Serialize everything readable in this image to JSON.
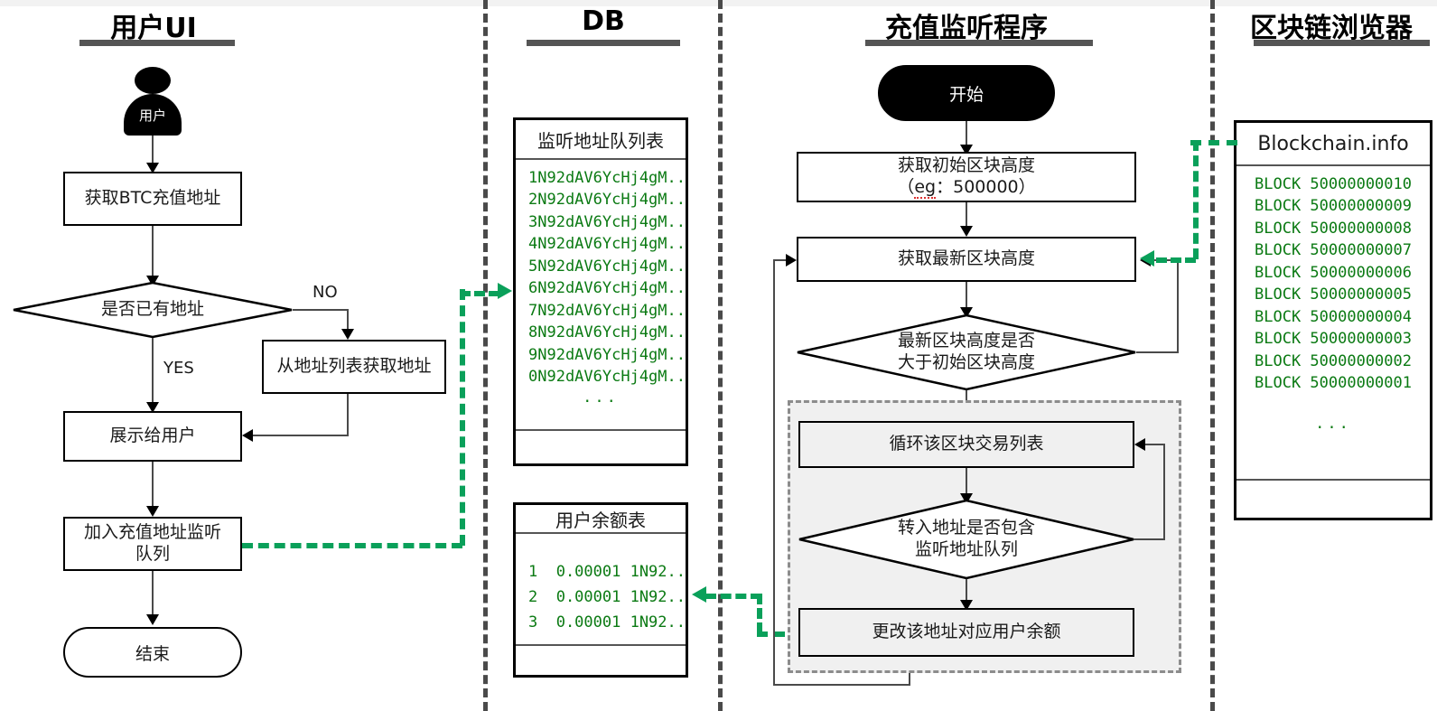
{
  "columns": [
    {
      "id": "user-ui",
      "title": "用户UI"
    },
    {
      "id": "db",
      "title": "DB"
    },
    {
      "id": "listener",
      "title": "充值监听程序"
    },
    {
      "id": "explorer",
      "title": "区块链浏览器"
    }
  ],
  "user_ui": {
    "actor_label": "用户",
    "nodes": [
      {
        "id": "get-btc-address",
        "label": "获取BTC充值地址"
      },
      {
        "id": "has-address-decision",
        "label": "是否已有地址"
      },
      {
        "id": "get-from-list",
        "label": "从地址列表获取地址"
      },
      {
        "id": "show-to-user",
        "label": "展示给用户"
      },
      {
        "id": "join-watch-queue",
        "label": "加入充值地址监听\n队列"
      },
      {
        "id": "end",
        "label": "结束"
      }
    ],
    "edge_no": "NO",
    "edge_yes": "YES"
  },
  "db": {
    "address_table": {
      "title": "监听地址队列表",
      "rows": [
        "1N92dAV6YcHj4gM...",
        "2N92dAV6YcHj4gM...",
        "3N92dAV6YcHj4gM...",
        "4N92dAV6YcHj4gM...",
        "5N92dAV6YcHj4gM...",
        "6N92dAV6YcHj4gM...",
        "7N92dAV6YcHj4gM...",
        "8N92dAV6YcHj4gM...",
        "9N92dAV6YcHj4gM...",
        "0N92dAV6YcHj4gM..."
      ],
      "ellipsis": "..."
    },
    "balance_table": {
      "title": "用户余额表",
      "rows": [
        "1  0.00001 1N92...",
        "2  0.00001 1N92...",
        "3  0.00001 1N92..."
      ],
      "ellipsis": "..."
    }
  },
  "listener": {
    "start": "开始",
    "get_initial_height_line1": "获取初始区块高度",
    "get_initial_height_line2_pre": "（",
    "get_initial_height_eg": "eg",
    "get_initial_height_line2_post": "：500000）",
    "get_latest_height": "获取最新区块高度",
    "compare_decision": "最新区块高度是否\n大于初始区块高度",
    "loop_tx_list": "循环该区块交易列表",
    "contains_decision": "转入地址是否包含\n监听地址队列",
    "update_balance": "更改该地址对应用户余额"
  },
  "explorer": {
    "site_title": "Blockchain.info",
    "blocks": [
      "BLOCK 50000000010",
      "BLOCK 50000000009",
      "BLOCK 50000000008",
      "BLOCK 50000000007",
      "BLOCK 50000000006",
      "BLOCK 50000000005",
      "BLOCK 50000000004",
      "BLOCK 50000000003",
      "BLOCK 50000000002",
      "BLOCK 50000000001"
    ],
    "ellipsis": "..."
  },
  "colors": {
    "green_flow": "#0aa05a",
    "green_text": "#0b7a13",
    "rule": "#555555",
    "line": "#4a4a4a",
    "shade": "#f0f0f0"
  }
}
